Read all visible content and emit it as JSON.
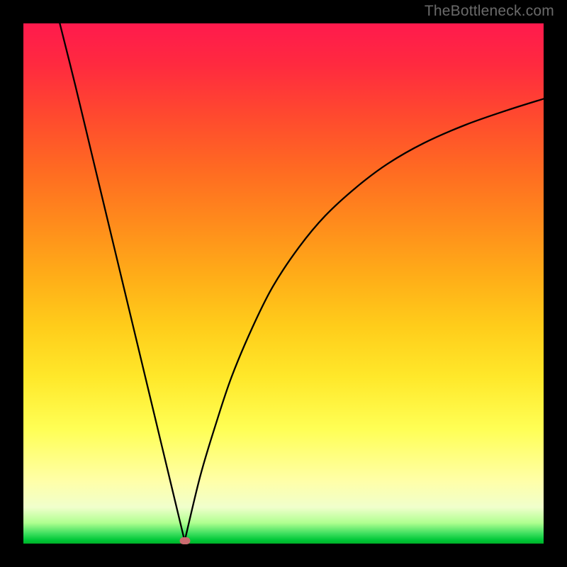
{
  "watermark": "TheBottleneck.com",
  "chart_data": {
    "type": "line",
    "title": "",
    "xlabel": "",
    "ylabel": "",
    "x_range": [
      0,
      100
    ],
    "y_range": [
      0,
      100
    ],
    "x_min_at": 31,
    "series": [
      {
        "name": "curve",
        "branch": "left",
        "x": [
          7,
          10,
          13,
          16,
          19,
          22,
          25,
          28,
          31
        ],
        "y": [
          100,
          88,
          75.5,
          63,
          50.5,
          38,
          25.5,
          13,
          0.5
        ]
      },
      {
        "name": "curve",
        "branch": "right",
        "x": [
          31,
          34,
          37,
          40,
          44,
          48,
          53,
          58,
          64,
          70,
          77,
          85,
          93,
          100
        ],
        "y": [
          0.5,
          13,
          23,
          32,
          41.5,
          49.5,
          57,
          63,
          68.5,
          73,
          77,
          80.5,
          83.3,
          85.5
        ]
      }
    ],
    "marker": {
      "x": 31,
      "y": 0.5,
      "color": "#cc6b70"
    },
    "gradient_stops": [
      {
        "pos": 0,
        "color": "#ff1a4d"
      },
      {
        "pos": 50,
        "color": "#ffab18"
      },
      {
        "pos": 78,
        "color": "#ffff55"
      },
      {
        "pos": 96,
        "color": "#b0ff90"
      },
      {
        "pos": 100,
        "color": "#00b028"
      }
    ]
  }
}
